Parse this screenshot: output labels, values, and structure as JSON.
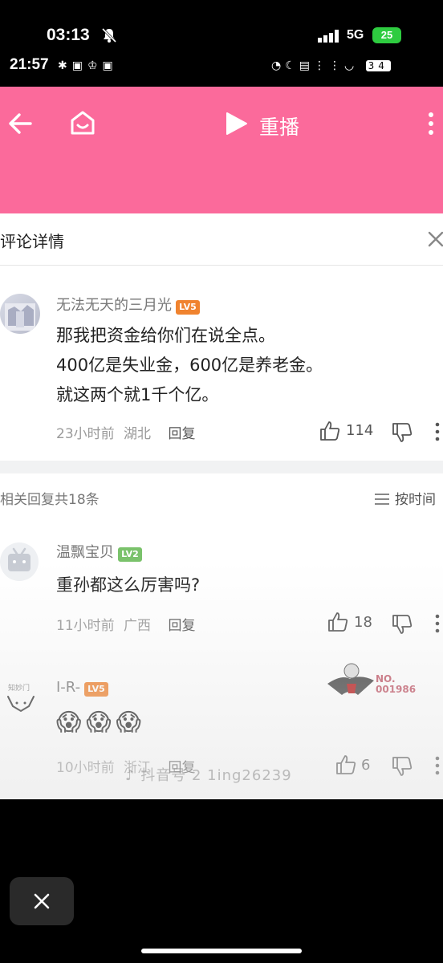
{
  "status_bar": {
    "time": "03:13",
    "network": "5G",
    "battery": "25"
  },
  "inner_status": {
    "time": "21:57",
    "battery": "34"
  },
  "header": {
    "replay_label": "重播"
  },
  "comment_detail": {
    "title": "评论详情",
    "main": {
      "username": "无法无天的三月光",
      "level": "LV5",
      "lines": [
        "那我把资金给你们在说全点。",
        "400亿是失业金，600亿是养老金。",
        "就这两个就1千个亿。"
      ],
      "time": "23小时前",
      "location": "湖北",
      "reply_label": "回复",
      "likes": "114"
    },
    "related_label": "相关回复共18条",
    "sort_label": "按时间",
    "replies": [
      {
        "username": "温飘宝贝",
        "level": "LV2",
        "text": "重孙都这么厉害吗?",
        "time": "11小时前",
        "location": "广西",
        "reply_label": "回复",
        "likes": "18"
      },
      {
        "username": "I-R-",
        "level": "LV5",
        "avatar_text": "知妙门",
        "badge_text": "NO.\n001986",
        "emojis": "😱😱😱",
        "time": "10小时前",
        "location": "浙江",
        "reply_label": "回复",
        "likes": "6"
      }
    ],
    "watermark": "抖音号 2 1ing26239"
  }
}
